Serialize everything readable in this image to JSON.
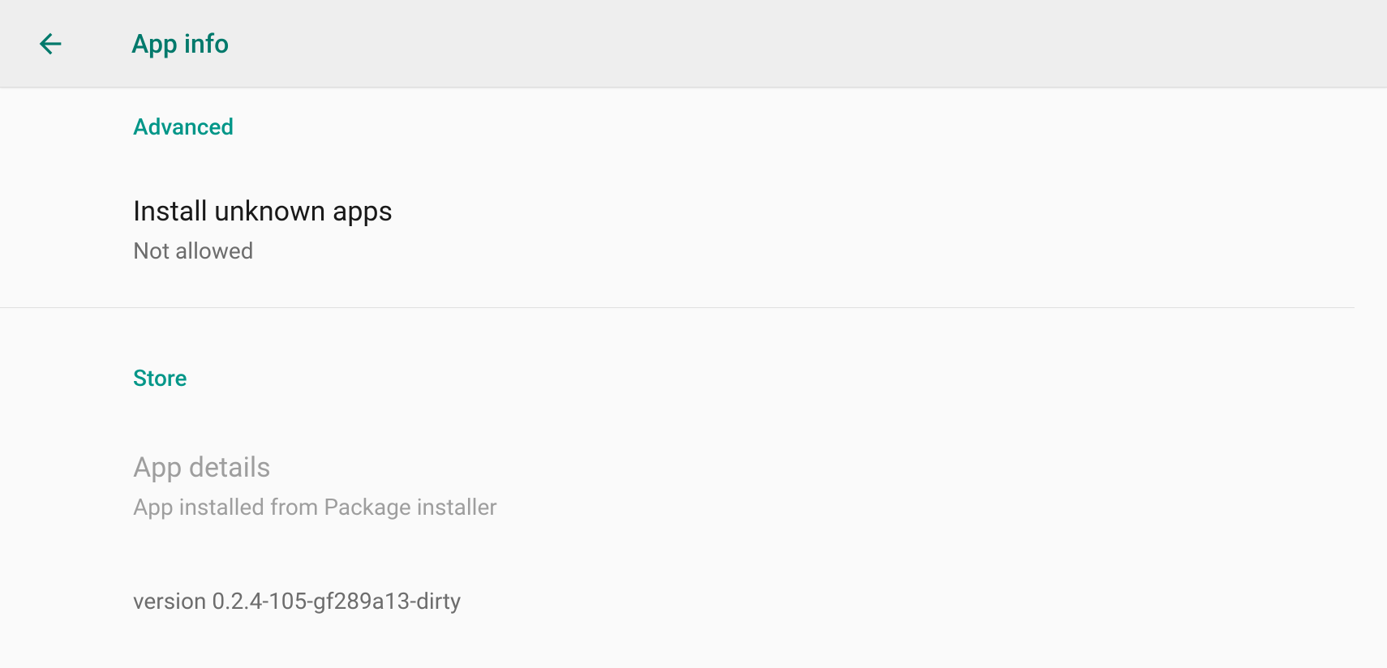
{
  "header": {
    "title": "App info"
  },
  "sections": {
    "advanced": {
      "header": "Advanced",
      "install_unknown": {
        "title": "Install unknown apps",
        "subtitle": "Not allowed"
      }
    },
    "store": {
      "header": "Store",
      "app_details": {
        "title": "App details",
        "subtitle": "App installed from Package installer"
      },
      "version": "version 0.2.4-105-gf289a13-dirty"
    }
  },
  "colors": {
    "accent": "#009688",
    "header_bg": "#eeeeee",
    "content_bg": "#fafafa"
  }
}
